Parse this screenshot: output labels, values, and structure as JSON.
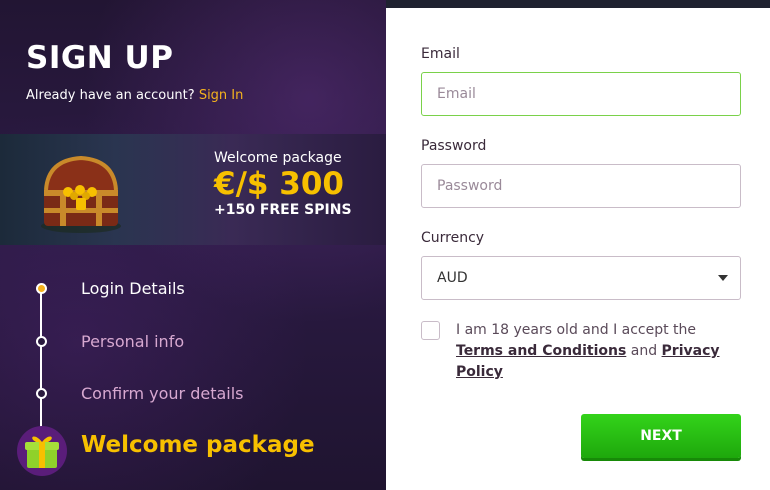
{
  "signup": {
    "title": "SIGN UP",
    "already_text": "Already have an account?",
    "signin_link": "Sign In"
  },
  "promo": {
    "label": "Welcome package",
    "amount": "€/$ 300",
    "spins": "+150 FREE SPINS"
  },
  "steps": [
    {
      "label": "Login Details",
      "active": true
    },
    {
      "label": "Personal info",
      "active": false
    },
    {
      "label": "Confirm your details",
      "active": false
    }
  ],
  "welcome_package_label": "Welcome package",
  "form": {
    "email": {
      "label": "Email",
      "placeholder": "Email",
      "value": ""
    },
    "password": {
      "label": "Password",
      "placeholder": "Password",
      "value": ""
    },
    "currency": {
      "label": "Currency",
      "value": "AUD"
    },
    "terms": {
      "prefix": "I am 18 years old and I accept the",
      "terms_link": "Terms and Conditions",
      "and": "and",
      "privacy_link": "Privacy Policy",
      "checked": false
    },
    "next_button": "NEXT"
  },
  "colors": {
    "accent_yellow": "#f7c000",
    "link_orange": "#f5b21e",
    "button_green": "#24b80f",
    "focus_green": "#7ad14a",
    "panel_purple": "#2a1a3e"
  }
}
